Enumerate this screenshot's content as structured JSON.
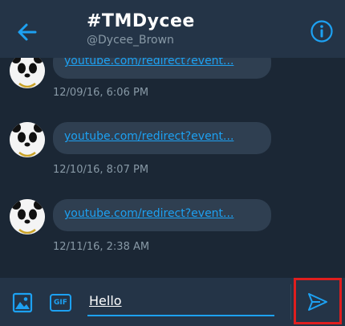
{
  "header": {
    "title": "#TMDycee",
    "username": "@Dycee_Brown",
    "back_icon": "arrow-left-icon",
    "info_icon": "info-circle-icon"
  },
  "messages": [
    {
      "link": "youtube.com/redirect?event...",
      "time": "12/09/16, 6:06 PM"
    },
    {
      "link": "youtube.com/redirect?event...",
      "time": "12/10/16, 8:07 PM"
    },
    {
      "link": "youtube.com/redirect?event...",
      "time": "12/11/16, 2:38 AM"
    }
  ],
  "composer": {
    "gif_label": "GIF",
    "input_value": "Hello",
    "image_icon": "image-icon",
    "send_icon": "send-icon"
  },
  "colors": {
    "accent": "#1da1f2",
    "background": "#1b2735",
    "header": "#243447",
    "bubble": "#2f3f51",
    "highlight": "#e01e1e"
  }
}
